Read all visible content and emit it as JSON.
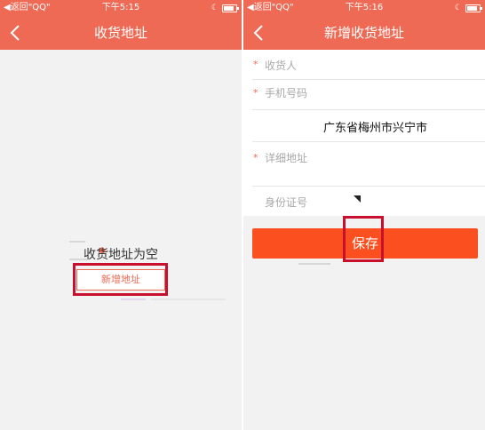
{
  "left": {
    "status": {
      "back": "◀返回\"QQ\"",
      "time": "下午5:15"
    },
    "nav": {
      "title": "收货地址"
    },
    "empty_text": "收货地址为空",
    "add_button": "新增地址"
  },
  "right": {
    "status": {
      "back": "◀返回\"QQ\"",
      "time": "下午5:16"
    },
    "nav": {
      "title": "新增收货地址"
    },
    "form": {
      "consignee_label": "收货人",
      "phone_label": "手机号码",
      "region_value": "广东省梅州市兴宁市",
      "detail_label": "详细地址",
      "id_label": "身份证号"
    },
    "save_button": "保存"
  },
  "colors": {
    "header": "#ef6a55",
    "save_button": "#fc4f20",
    "highlight_box": "#c8102e"
  }
}
